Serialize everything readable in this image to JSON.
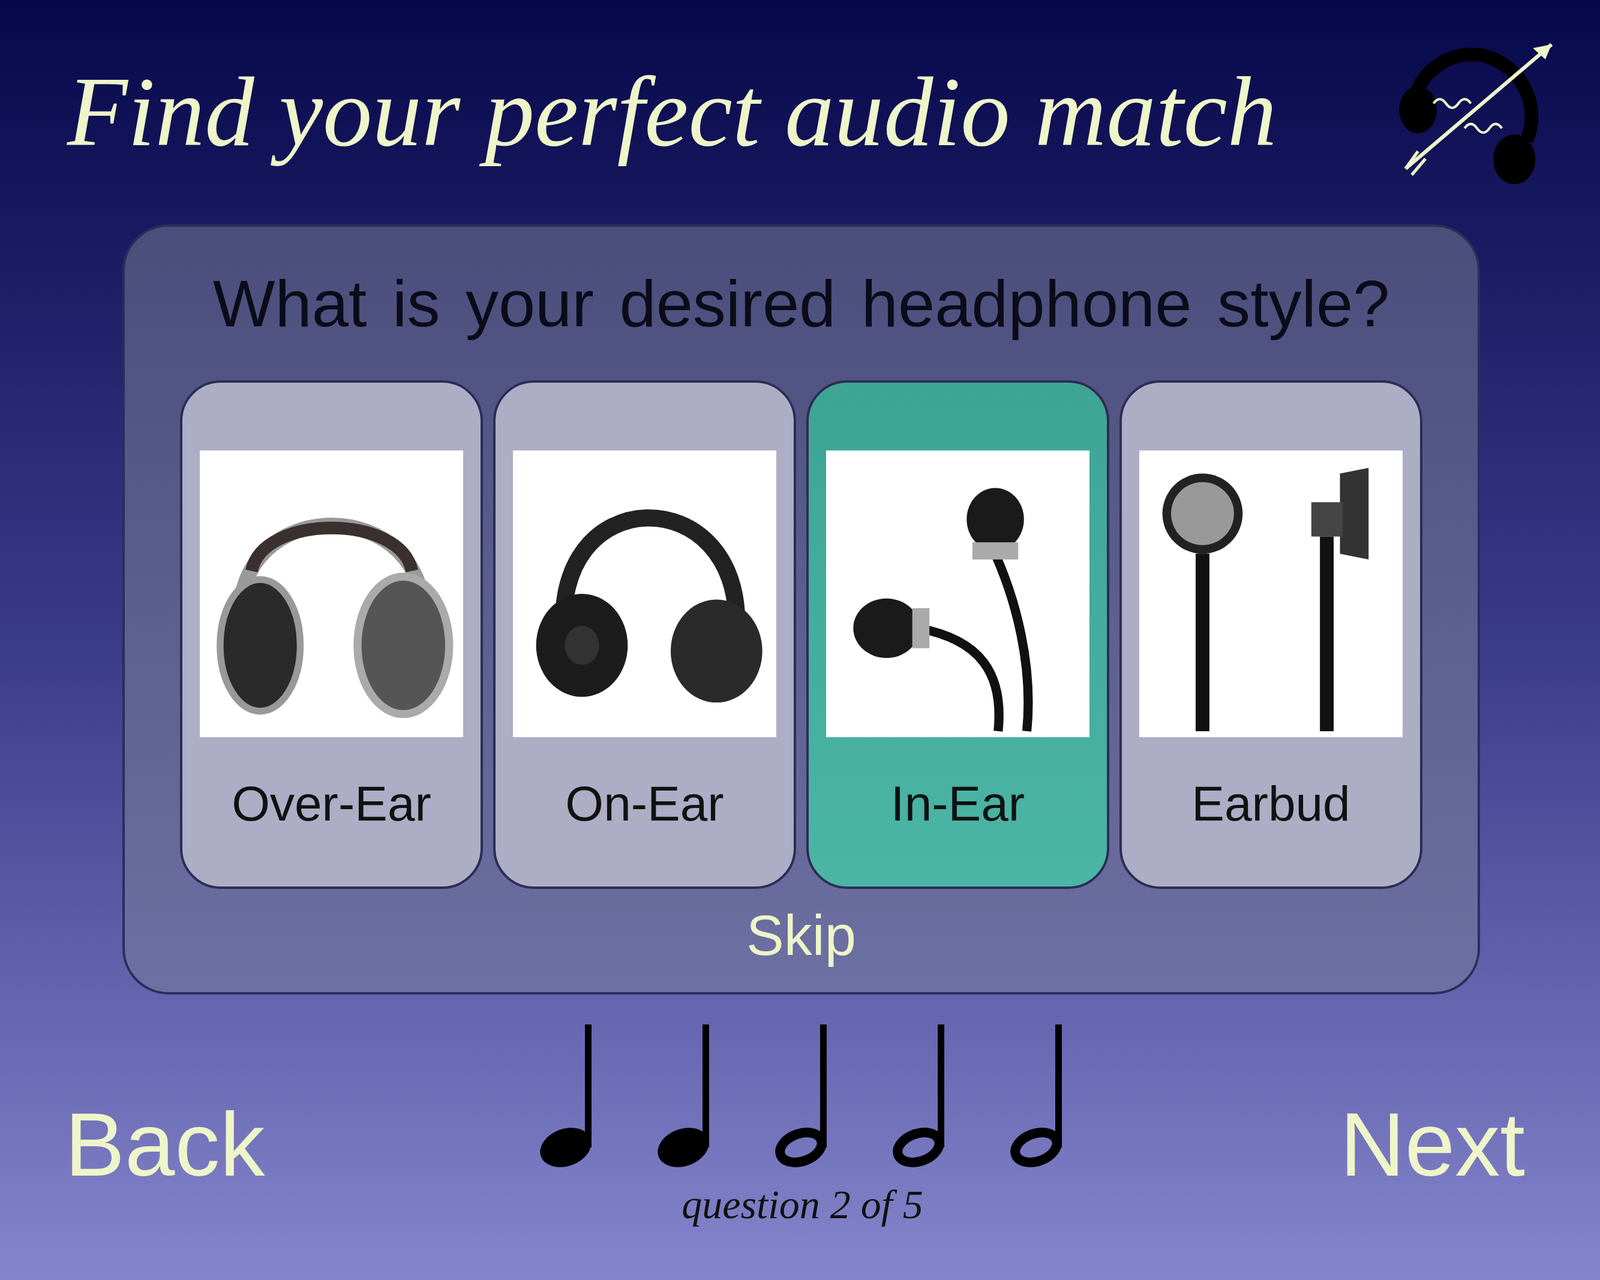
{
  "header": {
    "title": "Find your perfect audio match"
  },
  "question": {
    "text": "What is your desired headphone style?"
  },
  "options": [
    {
      "label": "Over-Ear",
      "selected": false
    },
    {
      "label": "On-Ear",
      "selected": false
    },
    {
      "label": "In-Ear",
      "selected": true
    },
    {
      "label": "Earbud",
      "selected": false
    }
  ],
  "skip": "Skip",
  "nav": {
    "back": "Back",
    "next": "Next"
  },
  "progress": {
    "steps": [
      {
        "filled": true
      },
      {
        "filled": true
      },
      {
        "filled": false
      },
      {
        "filled": false
      },
      {
        "filled": false
      }
    ],
    "caption": "question 2 of 5"
  }
}
